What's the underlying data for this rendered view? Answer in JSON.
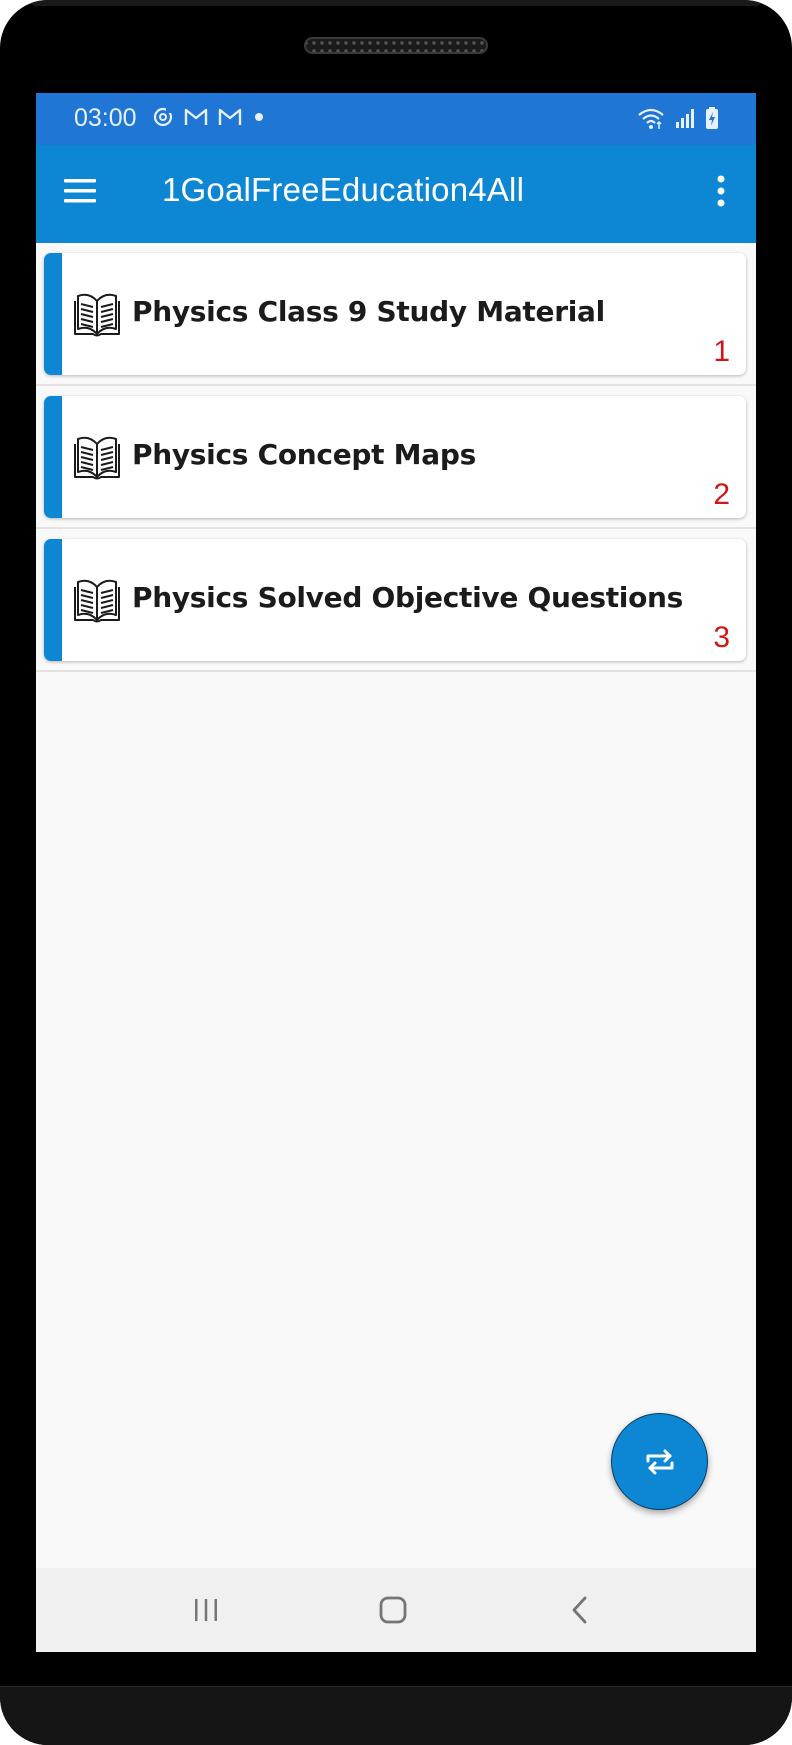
{
  "status_bar": {
    "time": "03:00",
    "left_icons": [
      "sync-icon",
      "gmail-icon",
      "gmail-icon",
      "dot-icon"
    ],
    "right_icons": [
      "wifi-icon",
      "signal-icon",
      "battery-charging-icon"
    ]
  },
  "app_bar": {
    "title": "1GoalFreeEducation4All",
    "menu_icon": "hamburger-menu-icon",
    "overflow_icon": "more-vertical-icon"
  },
  "list": {
    "items": [
      {
        "title": "Physics Class 9 Study Material",
        "number": "1",
        "icon": "open-book-icon"
      },
      {
        "title": "Physics Concept Maps",
        "number": "2",
        "icon": "open-book-icon"
      },
      {
        "title": "Physics Solved Objective Questions",
        "number": "3",
        "icon": "open-book-icon"
      }
    ]
  },
  "fab": {
    "icon": "repeat-icon"
  },
  "nav_bar": {
    "buttons": [
      "recent-apps-icon",
      "home-icon",
      "back-icon"
    ]
  },
  "colors": {
    "status_bar": "#1f76d4",
    "app_bar": "#0d87d3",
    "accent": "#0d87d3",
    "number": "#d01616",
    "background": "#f9f9f9"
  }
}
